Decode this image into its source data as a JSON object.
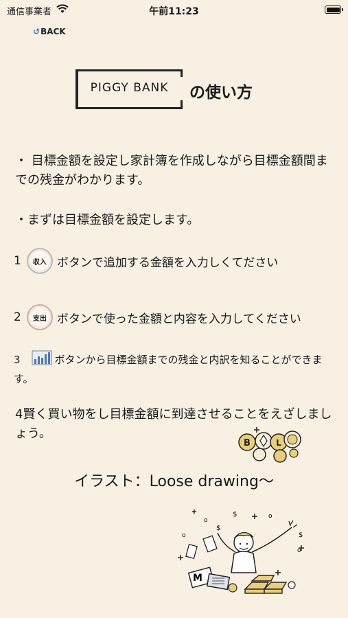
{
  "status_bar": {
    "carrier": "通信事業者",
    "time": "午前11:23"
  },
  "nav": {
    "back_label": "BACK"
  },
  "header": {
    "logo_text": "PIGGY BANK",
    "title_suffix": "の使い方"
  },
  "content": {
    "intro": "・ 目標金額を設定し家計簿を作成しながら目標金額間までの残金がわかります。",
    "first_step": "・まずは目標金額を設定します。",
    "step1": {
      "num": "1",
      "button_label": "収入",
      "text": "ボタンで追加する金額を入力しくてださい"
    },
    "step2": {
      "num": "2",
      "button_label": "支出",
      "text": "ボタンで使った金額と内容を入力してください"
    },
    "step3": {
      "num": "3",
      "text": "ボタンから目標金額までの残金と内訳を知ることができます。"
    },
    "step4": "4賢く買い物をし目標金額に到達させることをえざしましょう。"
  },
  "credit": "イラスト：Loose drawing〜"
}
